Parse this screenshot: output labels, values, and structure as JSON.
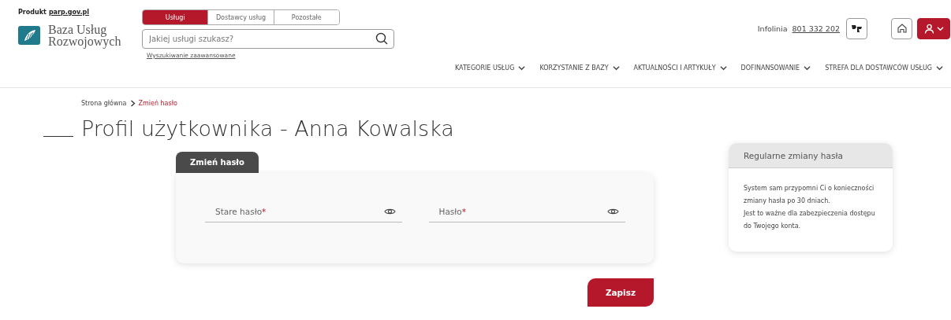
{
  "header": {
    "product_label": "Produkt",
    "product_link": "parp.gov.pl",
    "logo_lines": [
      "Baza Usług",
      "Rozwojowych"
    ],
    "search_tabs": [
      {
        "label": "Usługi",
        "selected": true
      },
      {
        "label": "Dostawcy usług",
        "selected": false
      },
      {
        "label": "Pozostałe",
        "selected": false
      }
    ],
    "search": {
      "placeholder": "Jakiej usługi szukasz?"
    },
    "advanced_search": "Wyszukiwanie zaawansowane",
    "hotline_label": "Infolinia",
    "hotline_number": "801 332 202",
    "nav": [
      "KATEGORIE USŁUG",
      "KORZYSTANIE Z BAZY",
      "AKTUALNOŚCI I ARTYKUŁY",
      "DOFINANSOWANIE",
      "STREFA DLA DOSTAWCÓW USŁUG"
    ]
  },
  "breadcrumb": [
    {
      "label": "Strona główna",
      "selected": false
    },
    {
      "label": "Zmień hasło",
      "selected": true
    }
  ],
  "page_title": "Profil użytkownika - Anna Kowalska",
  "form": {
    "tab": "Zmień hasło",
    "fields": [
      {
        "label": "Stare hasło",
        "required_mark": "*"
      },
      {
        "label": "Hasło",
        "required_mark": "*"
      }
    ],
    "submit": "Zapisz"
  },
  "info_card": {
    "title": "Regularne zmiany hasła",
    "paragraphs": [
      "System sam przypomni Ci o konieczności zmiany hasła po 30 dniach.",
      "Jest to ważne dla zabezpieczenia dostępu do Twojego konta."
    ]
  }
}
